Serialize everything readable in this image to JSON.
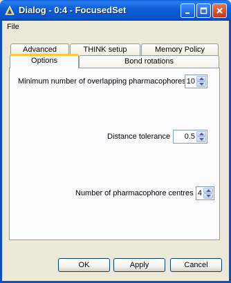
{
  "window": {
    "title": "Dialog - 0:4 - FocusedSet"
  },
  "menu": {
    "file": "File"
  },
  "tabs": {
    "row1": [
      "Advanced",
      "THINK setup",
      "Memory Policy"
    ],
    "row2": [
      "Options",
      "Bond rotations"
    ],
    "active": "Options"
  },
  "options": {
    "overlap": {
      "label": "Minimum number of overlapping pharmacophores",
      "value": "10"
    },
    "tolerance": {
      "label": "Distance tolerance",
      "value": "0.5"
    },
    "centres": {
      "label": "Number of pharmacophore centres",
      "value": "4"
    }
  },
  "buttons": {
    "ok": "OK",
    "apply": "Apply",
    "cancel": "Cancel"
  },
  "colors": {
    "titlebar": "#0e5fd9",
    "active_tab_accent": "#ffc83c",
    "dialog_bg": "#ece9d8"
  }
}
